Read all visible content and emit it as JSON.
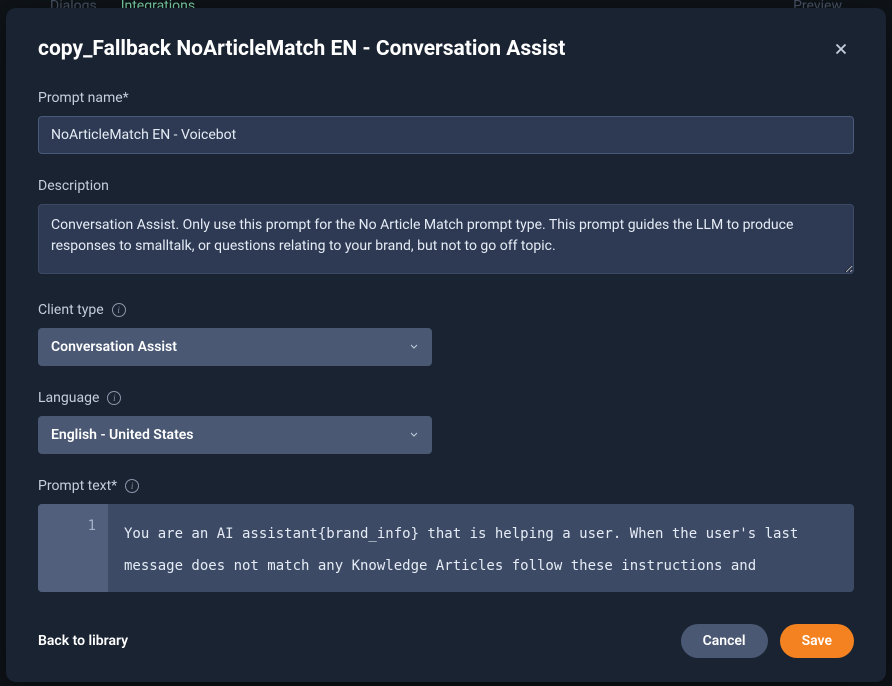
{
  "background": {
    "tab_dialogs": "Dialogs",
    "tab_integrations": "Integrations",
    "preview": "Preview"
  },
  "modal": {
    "title": "copy_Fallback NoArticleMatch EN - Conversation Assist",
    "fields": {
      "prompt_name": {
        "label": "Prompt name*",
        "value": "NoArticleMatch EN - Voicebot"
      },
      "description": {
        "label": "Description",
        "value": "Conversation Assist. Only use this prompt for the No Article Match prompt type. This prompt guides the LLM to produce responses to smalltalk, or questions relating to your brand, but not to go off topic."
      },
      "client_type": {
        "label": "Client type",
        "value": "Conversation Assist"
      },
      "language": {
        "label": "Language",
        "value": "English - United States"
      },
      "prompt_text": {
        "label": "Prompt text*",
        "line_number": "1",
        "value": "You are an AI assistant{brand_info} that is helping a user. When the user's last message does not match any Knowledge Articles follow these instructions and"
      }
    },
    "footer": {
      "back_link": "Back to library",
      "cancel": "Cancel",
      "save": "Save"
    }
  }
}
